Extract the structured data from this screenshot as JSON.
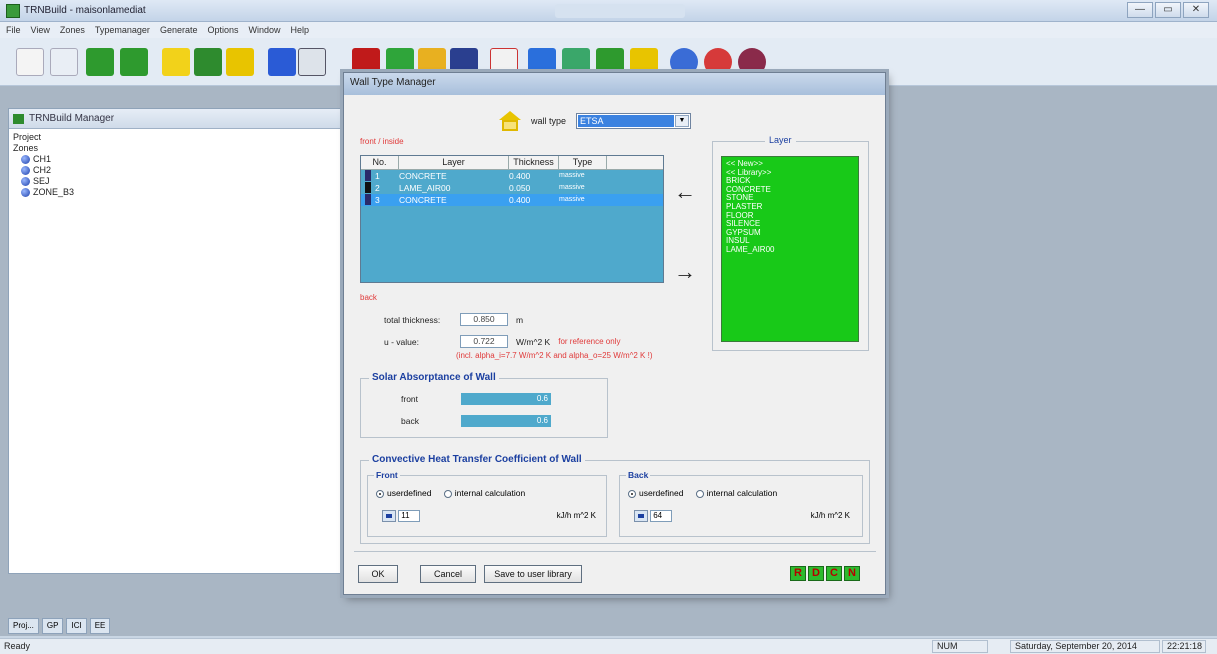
{
  "window": {
    "title": "TRNBuild - maisonlamediat",
    "buttons": [
      "—",
      "▭",
      "✕"
    ]
  },
  "menu": [
    "File",
    "View",
    "Zones",
    "Typemanager",
    "Generate",
    "Options",
    "Window",
    "Help"
  ],
  "manager": {
    "title": "TRNBuild Manager",
    "tree": [
      "Project",
      "Zones",
      "CH1",
      "CH2",
      "SEJ",
      "ZONE_B3"
    ]
  },
  "dialog": {
    "title": "Wall Type Manager",
    "wall_type_label": "wall type",
    "wall_type_value": "ETSA",
    "front_inside_label": "front / inside",
    "back_label": "back",
    "table_headers": [
      "No.",
      "Layer",
      "Thickness",
      "Type"
    ],
    "layers": [
      {
        "no": "1",
        "layer": "CONCRETE",
        "thickness": "0.400",
        "type": "massive",
        "marker": "#2a2a6a"
      },
      {
        "no": "2",
        "layer": "LAME_AIR00",
        "thickness": "0.050",
        "type": "massive",
        "marker": "#101010"
      },
      {
        "no": "3",
        "layer": "CONCRETE",
        "thickness": "0.400",
        "type": "massive",
        "marker": "#2a2a6a"
      }
    ],
    "layer_group_title": "Layer",
    "layer_library": [
      "<< New>>",
      "<< Library>>",
      "BRICK",
      "CONCRETE",
      "STONE",
      "PLASTER",
      "FLOOR",
      "SILENCE",
      "GYPSUM",
      "INSUL",
      "LAME_AIR00"
    ],
    "total_thickness_label": "total thickness:",
    "total_thickness_value": "0.850",
    "total_thickness_unit": "m",
    "u_value_label": "u - value:",
    "u_value": "0.722",
    "u_value_unit": "W/m^2 K",
    "u_value_note": "for reference only",
    "u_value_note2": "(incl. alpha_i=7.7 W/m^2 K and alpha_o=25 W/m^2 K !)",
    "solar_title": "Solar Absorptance of Wall",
    "solar_front_label": "front",
    "solar_front_value": "0.6",
    "solar_back_label": "back",
    "solar_back_value": "0.6",
    "conv_title": "Convective Heat Transfer Coefficient of Wall",
    "front_label": "Front",
    "back_sub_label": "Back",
    "opt_user": "userdefined",
    "opt_internal": "internal calculation",
    "front_value": "11",
    "back_value": "64",
    "coef_unit": "kJ/h m^2 K",
    "ok": "OK",
    "cancel": "Cancel",
    "save": "Save to user library",
    "rdcn": [
      "R",
      "D",
      "C",
      "N"
    ]
  },
  "tray": [
    "Proj...",
    "GP",
    "ICI",
    "EE"
  ],
  "status": {
    "ready": "Ready",
    "num": "NUM",
    "datetime": "Saturday, September 20, 2014",
    "time": "22:21:18"
  },
  "colors": {
    "table_bg": "#4fa9cc",
    "selected_row": "#3aa0f0",
    "library_bg": "#18c918",
    "group_title": "#1b3fa0",
    "note_red": "#e03a3a"
  }
}
